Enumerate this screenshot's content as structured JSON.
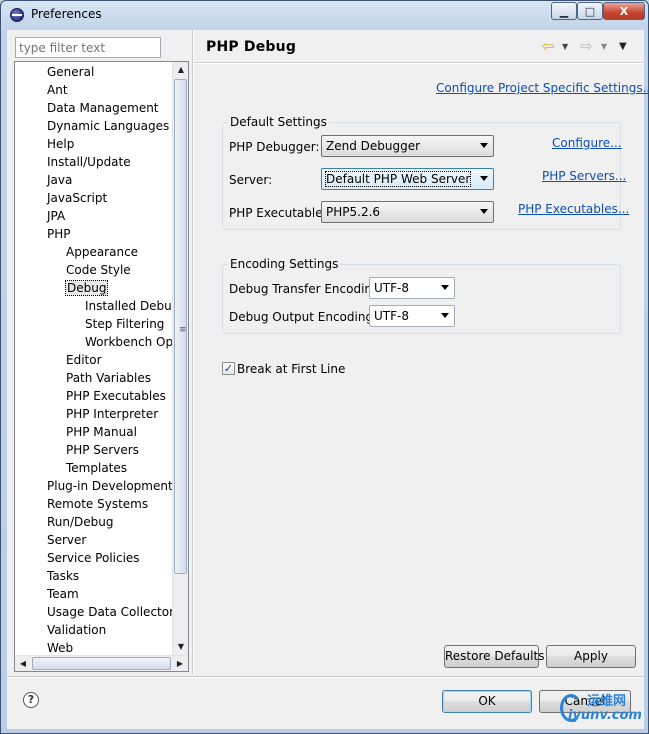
{
  "window": {
    "title": "Preferences",
    "buttons": {
      "minimize": "▁",
      "maximize": "□",
      "close": "X"
    }
  },
  "sidebar": {
    "filter_placeholder": "type filter text",
    "tree": [
      {
        "label": "General",
        "level": 0
      },
      {
        "label": "Ant",
        "level": 0
      },
      {
        "label": "Data Management",
        "level": 0
      },
      {
        "label": "Dynamic Languages",
        "level": 0
      },
      {
        "label": "Help",
        "level": 0
      },
      {
        "label": "Install/Update",
        "level": 0
      },
      {
        "label": "Java",
        "level": 0
      },
      {
        "label": "JavaScript",
        "level": 0
      },
      {
        "label": "JPA",
        "level": 0
      },
      {
        "label": "PHP",
        "level": 0
      },
      {
        "label": "Appearance",
        "level": 1
      },
      {
        "label": "Code Style",
        "level": 1
      },
      {
        "label": "Debug",
        "level": 1,
        "selected": true
      },
      {
        "label": "Installed Debuggers",
        "level": 2
      },
      {
        "label": "Step Filtering",
        "level": 2
      },
      {
        "label": "Workbench Options",
        "level": 2
      },
      {
        "label": "Editor",
        "level": 1
      },
      {
        "label": "Path Variables",
        "level": 1
      },
      {
        "label": "PHP Executables",
        "level": 1
      },
      {
        "label": "PHP Interpreter",
        "level": 1
      },
      {
        "label": "PHP Manual",
        "level": 1
      },
      {
        "label": "PHP Servers",
        "level": 1
      },
      {
        "label": "Templates",
        "level": 1
      },
      {
        "label": "Plug-in Development",
        "level": 0
      },
      {
        "label": "Remote Systems",
        "level": 0
      },
      {
        "label": "Run/Debug",
        "level": 0
      },
      {
        "label": "Server",
        "level": 0
      },
      {
        "label": "Service Policies",
        "level": 0
      },
      {
        "label": "Tasks",
        "level": 0
      },
      {
        "label": "Team",
        "level": 0
      },
      {
        "label": "Usage Data Collector",
        "level": 0
      },
      {
        "label": "Validation",
        "level": 0
      },
      {
        "label": "Web",
        "level": 0
      }
    ],
    "scroll_grip": "≡"
  },
  "page": {
    "title": "PHP Debug",
    "project_link": "Configure Project Specific Settings...",
    "default_settings": {
      "title": "Default Settings",
      "debugger_label": "PHP Debugger:",
      "debugger_value": "Zend Debugger",
      "debugger_link": "Configure...",
      "server_label": "Server:",
      "server_value": "Default PHP Web Server",
      "server_link": "PHP Servers...",
      "executable_label": "PHP Executable:",
      "executable_value": "PHP5.2.6",
      "executable_link": "PHP Executables..."
    },
    "encoding_settings": {
      "title": "Encoding Settings",
      "transfer_label": "Debug Transfer Encoding",
      "transfer_value": "UTF-8",
      "output_label": "Debug Output Encoding",
      "output_value": "UTF-8"
    },
    "break_first_line": {
      "label": "Break at First Line",
      "checked": true,
      "mark": "✓"
    },
    "restore_defaults": "Restore Defaults",
    "apply": "Apply"
  },
  "footer": {
    "help": "?",
    "ok": "OK",
    "cancel": "Cancel"
  },
  "watermark": {
    "top": "运维网",
    "bottom": "iyunv.com"
  },
  "icons": {
    "back": "⇦",
    "forward": "⇨",
    "dropdown": "▼",
    "scroll_up": "▲",
    "scroll_down": "▼",
    "scroll_left": "◀",
    "scroll_right": "▶"
  }
}
